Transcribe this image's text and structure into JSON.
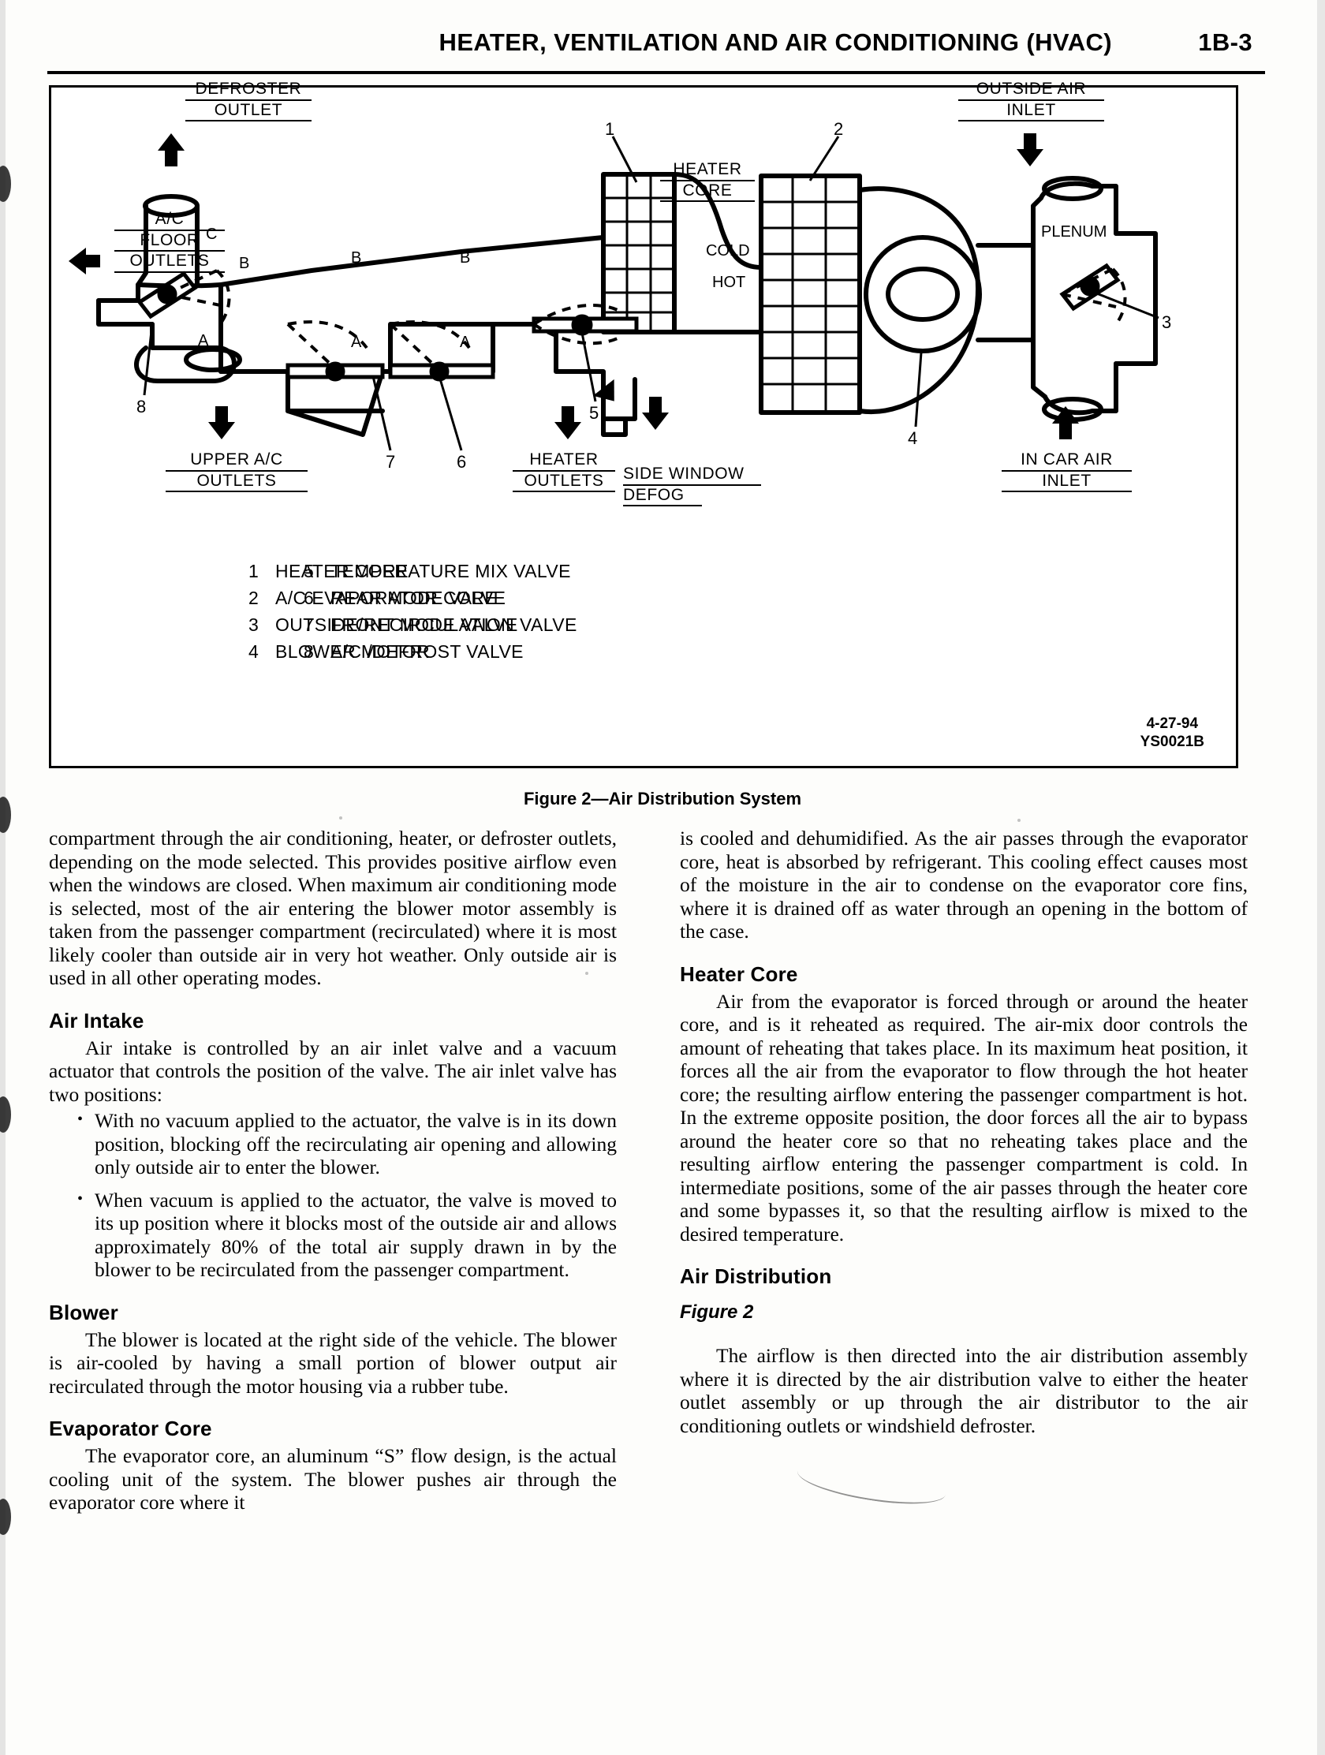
{
  "header": {
    "title": "HEATER, VENTILATION AND AIR CONDITIONING (HVAC)",
    "page_number": "1B-3"
  },
  "figure": {
    "caption": "Figure 2—Air Distribution System",
    "stamp_date": "4-27-94",
    "stamp_code": "YS0021B",
    "callouts": {
      "defroster_outlet_1": "DEFROSTER",
      "defroster_outlet_2": "OUTLET",
      "outside_air_1": "OUTSIDE AIR",
      "outside_air_2": "INLET",
      "plenum": "PLENUM",
      "ac_floor_1": "A/C",
      "ac_floor_2": "FLOOR",
      "ac_floor_3": "OUTLETS",
      "heater_core_1": "HEATER",
      "heater_core_2": "CORE",
      "cold": "COLD",
      "hot": "HOT",
      "upper_ac_1": "UPPER A/C",
      "upper_ac_2": "OUTLETS",
      "heater_outlets_1": "HEATER",
      "heater_outlets_2": "OUTLETS",
      "side_window_1": "SIDE WINDOW",
      "side_window_2": "DEFOG",
      "in_car_air_1": "IN CAR AIR",
      "in_car_air_2": "INLET"
    },
    "index_numbers": [
      "1",
      "2",
      "3",
      "4",
      "5",
      "6",
      "7",
      "8"
    ],
    "valve_letters": [
      "C",
      "B",
      "A",
      "B",
      "A",
      "B",
      "A"
    ],
    "legend_left": [
      {
        "n": "1",
        "label": "HEATER CORE"
      },
      {
        "n": "2",
        "label": "A/C EVAPORATOR CORE"
      },
      {
        "n": "3",
        "label": "OUTSIDE/RECIRCULATION VALVE"
      },
      {
        "n": "4",
        "label": "BLOWER MOTOR"
      }
    ],
    "legend_right": [
      {
        "n": "5",
        "label": "TEMPERATURE MIX VALVE"
      },
      {
        "n": "6",
        "label": "REAR MODE VALVE"
      },
      {
        "n": "7",
        "label": "FRONT MODE VALVE"
      },
      {
        "n": "8",
        "label": "A/C /DEFROST VALVE"
      }
    ]
  },
  "left_column": {
    "lead_paragraph": "compartment through the air conditioning, heater, or defroster outlets, depending on the mode selected. This provides positive airflow even when the windows are closed. When maximum air conditioning mode is selected, most of the air entering the blower motor assembly is taken from the passenger compartment (recirculated) where it is most likely cooler than outside air in very hot weather. Only outside air is used in all other operating modes.",
    "air_intake_heading": "Air Intake",
    "air_intake_paragraph": "Air intake is controlled by an air inlet valve and a vacuum actuator that controls the position of the valve. The air inlet valve has two positions:",
    "bullet_1": "With no vacuum applied to the actuator, the valve is in its down position, blocking off the recirculating air opening and allowing only outside air to enter the blower.",
    "bullet_2": "When vacuum is applied to the actuator, the valve is moved to its up position where it blocks most of the outside air and allows approximately 80% of the total air supply drawn in by the blower to be recirculated from the passenger compartment.",
    "blower_heading": "Blower",
    "blower_paragraph": "The blower is located at the right side of the vehicle. The blower is air-cooled by having a small portion of blower output air recirculated through the motor housing via a rubber tube.",
    "evaporator_heading": "Evaporator Core",
    "evaporator_paragraph": "The evaporator core, an aluminum “S” flow design, is the actual cooling unit of the system. The blower pushes air through the evaporator core where it"
  },
  "right_column": {
    "lead_paragraph": "is cooled and dehumidified. As the air passes through the evaporator core, heat is absorbed by refrigerant. This cooling effect causes most of the moisture in the air to condense on the evaporator core fins, where it is drained off as water through an opening in the bottom of the case.",
    "heater_core_heading": "Heater Core",
    "heater_core_paragraph": "Air from the evaporator is forced through or around the heater core, and is it reheated as required. The air-mix door controls the amount of reheating that takes place. In its maximum heat position, it forces all the air from the evaporator to flow through the hot heater core; the resulting airflow entering the passenger compartment is hot. In the extreme opposite position, the door forces all the air to bypass around the heater core so that no reheating takes place and the resulting airflow entering the passenger compartment is cold. In intermediate positions, some of the air passes through the heater core and some bypasses it, so that the resulting airflow is mixed to the desired temperature.",
    "air_distribution_heading": "Air Distribution",
    "figure_reference": "Figure 2",
    "air_distribution_paragraph": "The airflow is then directed into the air distribution assembly where it is directed by the air distribution valve to either the heater outlet assembly or up through the air distributor to the air conditioning outlets or windshield defroster."
  }
}
